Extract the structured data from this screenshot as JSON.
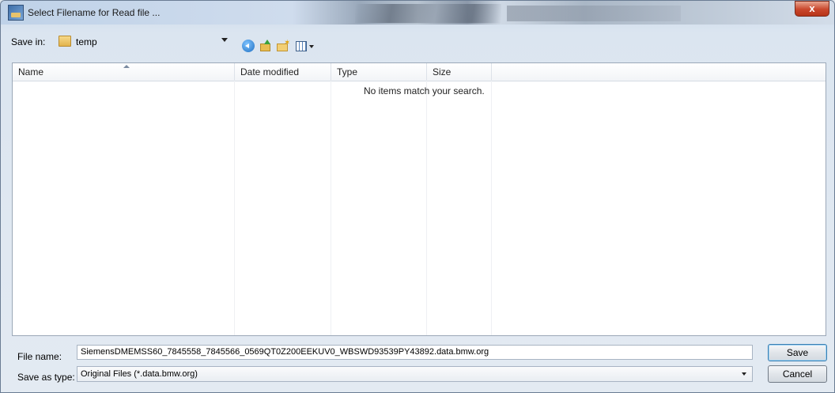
{
  "window": {
    "title": "Select Filename for Read file ...",
    "close_glyph": "x"
  },
  "toolbar": {
    "save_in_label": "Save in:",
    "current_folder": "temp",
    "icons": [
      "back-icon",
      "up-folder-icon",
      "new-folder-icon",
      "views-menu-icon"
    ]
  },
  "list": {
    "columns": [
      "Name",
      "Date modified",
      "Type",
      "Size"
    ],
    "empty_message": "No items match your search."
  },
  "form": {
    "filename_label": "File name:",
    "filename_value": "SiemensDMEMSS60_7845558_7845566_0569QT0Z200EEKUV0_WBSWD93539PY43892.data.bmw.org",
    "saveas_label": "Save as type:",
    "saveas_value": "Original Files (*.data.bmw.org)"
  },
  "buttons": {
    "save": "Save",
    "cancel": "Cancel"
  },
  "colors": {
    "close_button": "#c9472c",
    "list_background": "#ffffff",
    "dialog_background": "#e3eaf2"
  }
}
